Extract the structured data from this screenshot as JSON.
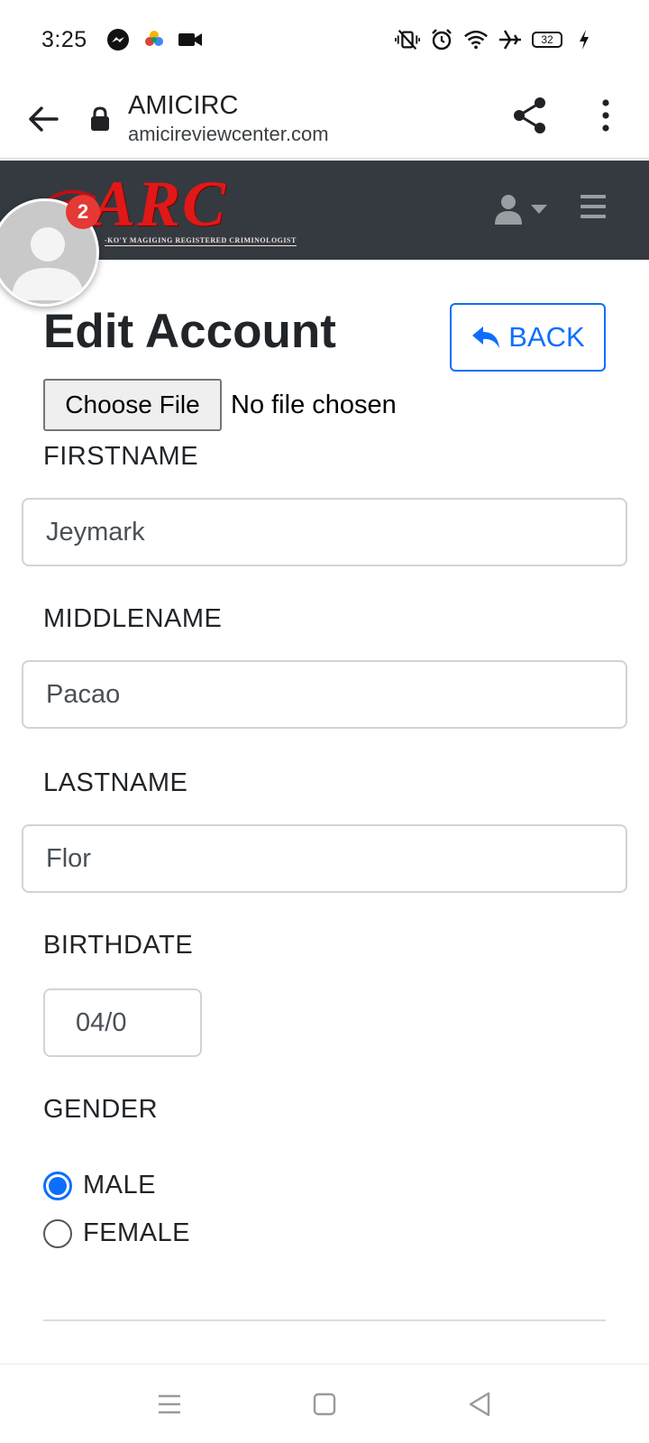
{
  "status_bar": {
    "time": "3:25",
    "left_icons": [
      "messenger-icon",
      "photos-icon",
      "video-icon"
    ],
    "right_icons": [
      "vibrate-icon",
      "alarm-icon",
      "wifi-icon",
      "airplane-icon"
    ],
    "battery": "32"
  },
  "browser": {
    "title": "AMICIRC",
    "domain": "amicireviewcenter.com"
  },
  "site_nav": {
    "logo_text": "ARC",
    "logo_tagline": "-KO'Y MAGIGING REGISTERED CRIMINOLOGIST"
  },
  "avatar": {
    "badge_count": "2"
  },
  "page": {
    "title": "Edit Account",
    "back_label": "BACK",
    "file_button": "Choose File",
    "file_status": "No file chosen"
  },
  "form": {
    "firstname_label": "FIRSTNAME",
    "firstname_value": "Jeymark",
    "middlename_label": "MIDDLENAME",
    "middlename_value": "Pacao",
    "lastname_label": "LASTNAME",
    "lastname_value": "Flor",
    "birthdate_label": "BIRTHDATE",
    "birthdate_value": "04/0",
    "gender_label": "GENDER",
    "gender_options": [
      {
        "label": "MALE",
        "checked": true
      },
      {
        "label": "FEMALE",
        "checked": false
      }
    ]
  },
  "colors": {
    "primary": "#0d6efd",
    "navbar": "#343a40",
    "logo_red": "#e01818",
    "badge_red": "#e53935"
  }
}
